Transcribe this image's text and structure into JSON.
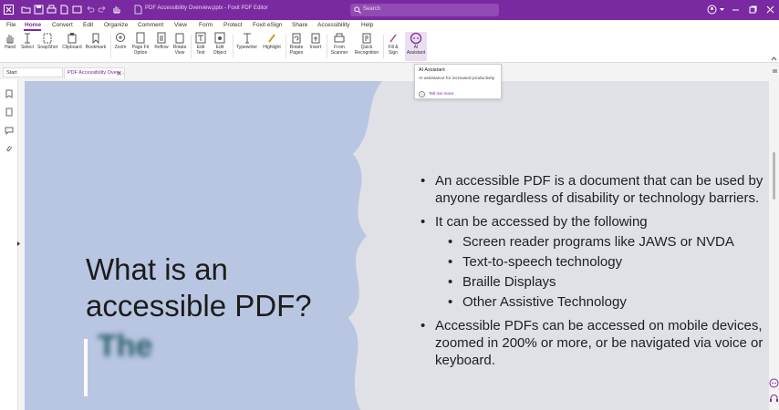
{
  "titlebar": {
    "title": "PDF Accessibility Overview.pptx - Foxit PDF Editor",
    "search_placeholder": "Search",
    "accent": "#7a2aa0"
  },
  "menu": {
    "items": [
      "File",
      "Home",
      "Convert",
      "Edit",
      "Organize",
      "Comment",
      "View",
      "Form",
      "Protect",
      "Foxit eSign",
      "Share",
      "Accessibility",
      "Help"
    ],
    "active": "Home"
  },
  "ribbon": {
    "hand": "Hand",
    "select": "Select",
    "snapshot": "SnapShot",
    "clipboard": "Clipboard",
    "bookmark": "Bookmark",
    "zoom": "Zoom",
    "page_fit_1": "Page Fit",
    "page_fit_2": "Option",
    "reflow": "Reflow",
    "rotate_view_1": "Rotate",
    "rotate_view_2": "View",
    "edit_text_1": "Edit",
    "edit_text_2": "Text",
    "edit_object_1": "Edit",
    "edit_object_2": "Object",
    "typewriter": "Typewriter",
    "highlight": "Highlight",
    "rotate_pages_1": "Rotate",
    "rotate_pages_2": "Pages",
    "insert": "Insert",
    "from_scanner_1": "From",
    "from_scanner_2": "Scanner",
    "quick_recognition_1": "Quick",
    "quick_recognition_2": "Recognition",
    "fill_sign_1": "Fill &",
    "fill_sign_2": "Sign",
    "ai_assistant_1": "AI",
    "ai_assistant_2": "Assistant"
  },
  "tabs": {
    "start": "Start",
    "document": "PDF Accessibility Overv..."
  },
  "tooltip": {
    "title": "AI Assistant",
    "description": "AI assistance for increased productivity",
    "link": "Tell me more"
  },
  "slide": {
    "title_line1": "What is an",
    "title_line2": "accessible PDF?",
    "blurred_text": "The",
    "bullet1": "An accessible PDF is a document that can be used by anyone regardless of disability or technology barriers.",
    "bullet2": "It can be accessed by the following",
    "sub1": "Screen reader programs like JAWS or NVDA",
    "sub2": "Text-to-speech technology",
    "sub3": "Braille Displays",
    "sub4": "Other Assistive Technology",
    "bullet3": "Accessible PDFs can be accessed on mobile devices, zoomed in 200% or more, or be navigated via voice or keyboard."
  }
}
